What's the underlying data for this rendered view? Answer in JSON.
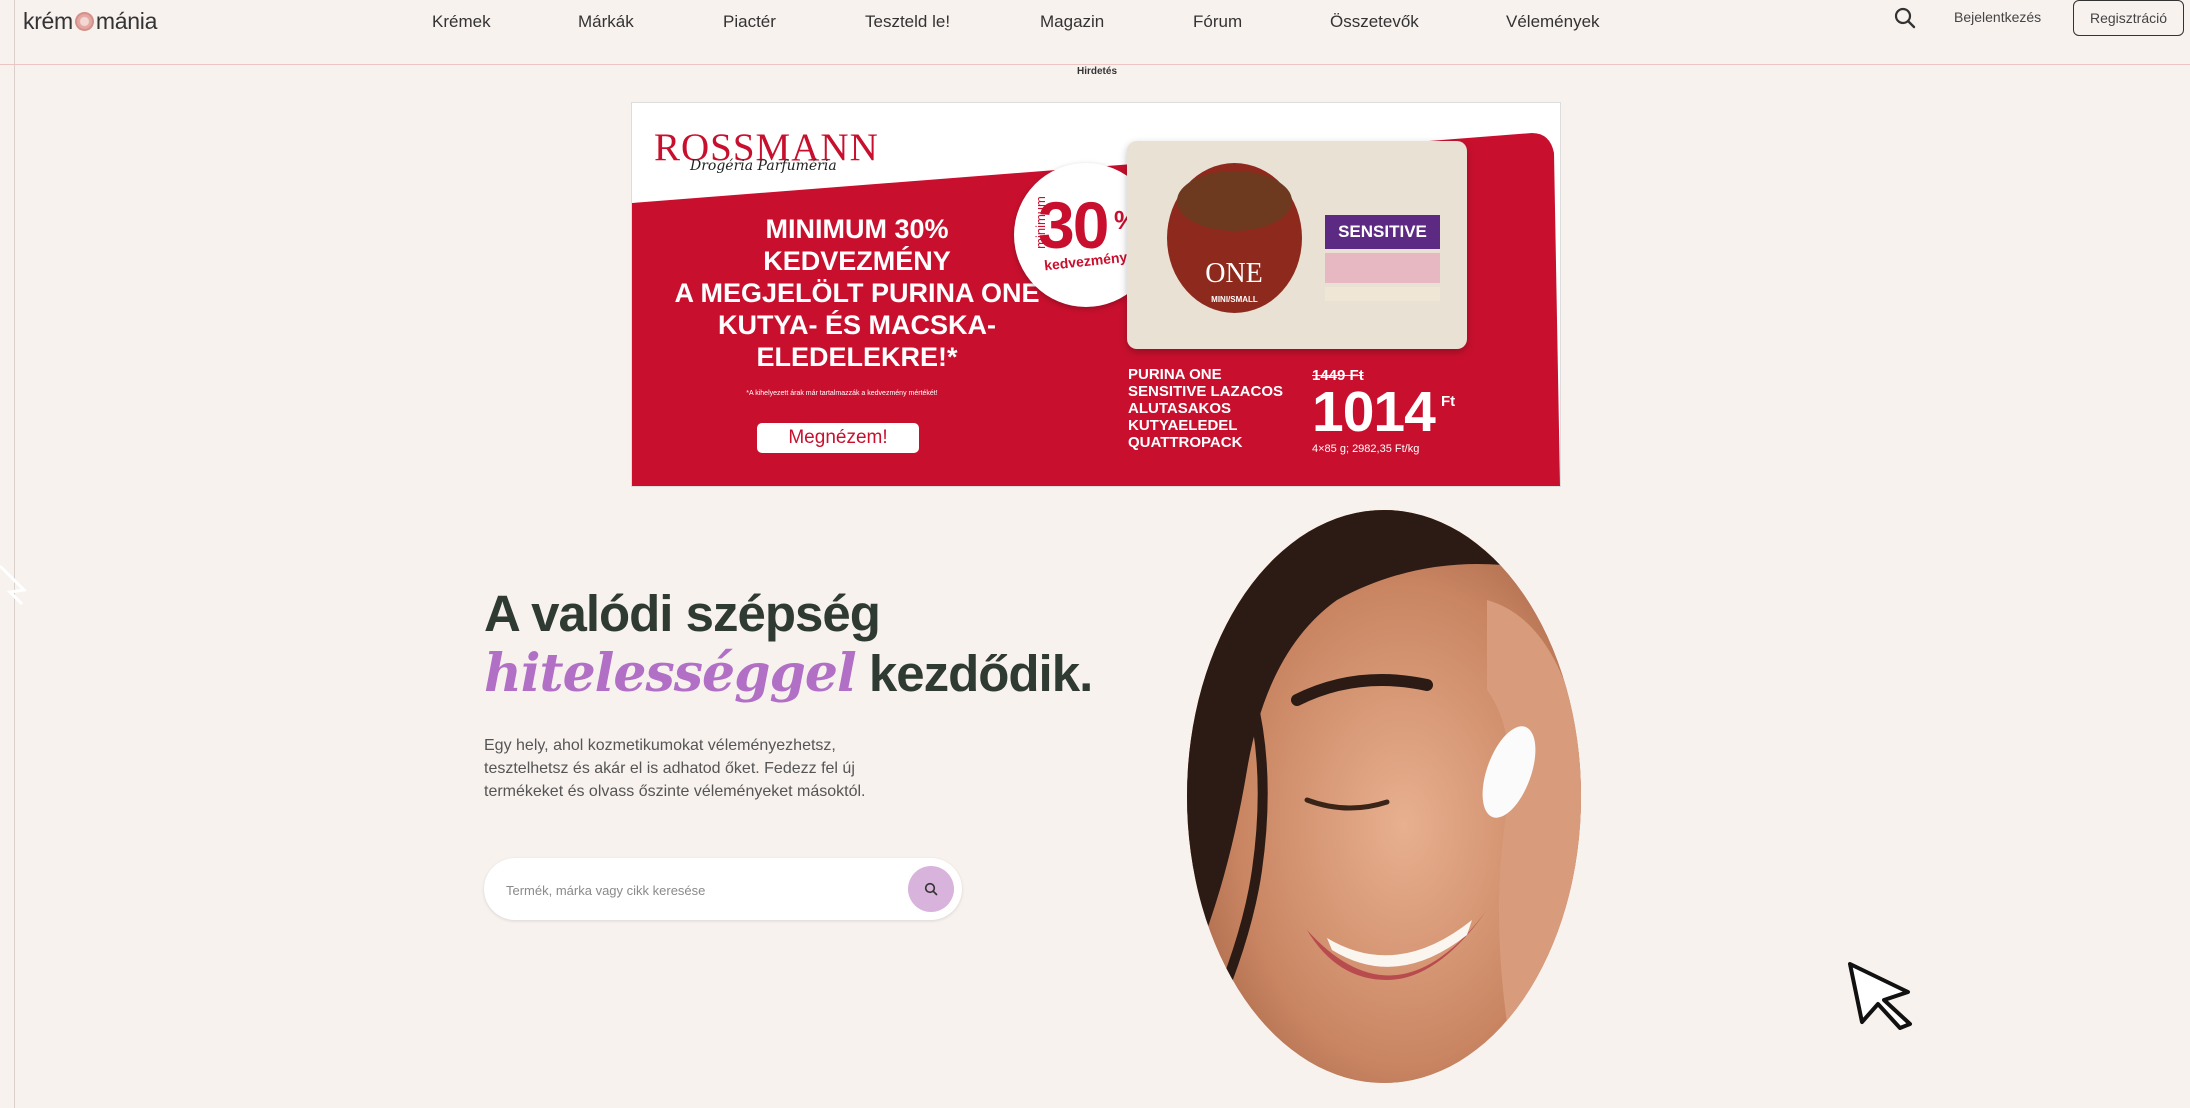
{
  "header": {
    "logo_left": "krém",
    "logo_right": "mánia",
    "nav": [
      "Krémek",
      "Márkák",
      "Piactér",
      "Teszteld le!",
      "Magazin",
      "Fórum",
      "Összetevők",
      "Vélemények"
    ],
    "search_icon": "search-icon",
    "login_label": "Bejelentkezés",
    "register_label": "Regisztráció"
  },
  "ad": {
    "label": "Hirdetés",
    "brand": "ROSSMANN",
    "brand_sub": "Drogéria Parfuméria",
    "headline_lines": [
      "MINIMUM 30%",
      "KEDVEZMÉNY",
      "A MEGJELÖLT PURINA ONE",
      "KUTYA- ÉS MACSKA-",
      "ELEDELEKRE!*"
    ],
    "fine_print": "*A kihelyezett árak már tartalmazzák a kedvezmény mértékét!",
    "cta": "Megnézem!",
    "badge_prefix": "minimum",
    "badge_value": "30",
    "badge_pct": "%",
    "badge_suffix": "kedvezmény",
    "product_brand": "ONE",
    "product_variant": "MINI/SMALL",
    "product_tag": "SENSITIVE",
    "product_name_lines": [
      "PURINA ONE",
      "SENSITIVE LAZACOS",
      "ALUTASAKOS",
      "KUTYAELEDEL",
      "QUATTROPACK"
    ],
    "old_price": "1449 Ft",
    "price": "1014",
    "currency": "Ft",
    "unit_price": "4×85 g; 2982,35 Ft/kg",
    "colors": {
      "red": "#c8102e",
      "purple": "#5c2a83"
    }
  },
  "hero": {
    "title_line1": "A valódi szépség",
    "title_accent": "hitelességgel",
    "title_rest": "kezdődik.",
    "description": "Egy hely, ahol kozmetikumokat véleményezhetsz, tesztelhetsz és akár el is adhatod őket. Fedezz fel új termékeket és olvass őszinte véleményeket másoktól.",
    "search_placeholder": "Termék, márka vagy cikk keresése",
    "search_value": "",
    "accent_color": "#b170c6"
  }
}
